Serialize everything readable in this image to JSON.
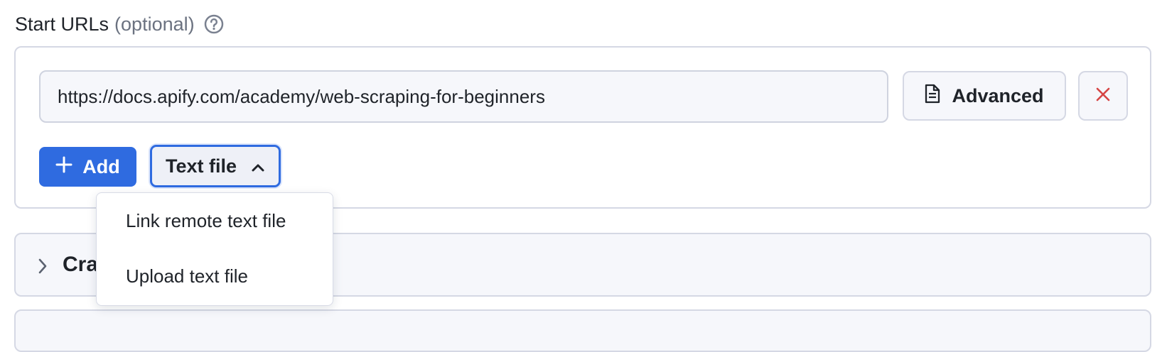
{
  "field": {
    "label": "Start URLs",
    "optional": "(optional)",
    "help_icon": "question-circle-icon"
  },
  "url_row": {
    "value": "https://docs.apify.com/academy/web-scraping-for-beginners",
    "advanced_label": "Advanced",
    "advanced_icon": "document-icon",
    "remove_icon": "close-icon"
  },
  "actions": {
    "add_label": "Add",
    "add_icon": "plus-icon",
    "text_file_label": "Text file",
    "text_file_icon": "chevron-up-icon"
  },
  "dropdown": {
    "items": [
      {
        "label": "Link remote text file"
      },
      {
        "label": "Upload text file"
      }
    ]
  },
  "sections": [
    {
      "title": "Cra",
      "icon": "chevron-right-icon"
    },
    {
      "title": ""
    }
  ],
  "colors": {
    "accent": "#2f6be0",
    "remove_red": "#d64545",
    "border": "#d5d8e4",
    "panel_bg": "#f6f7fb"
  }
}
